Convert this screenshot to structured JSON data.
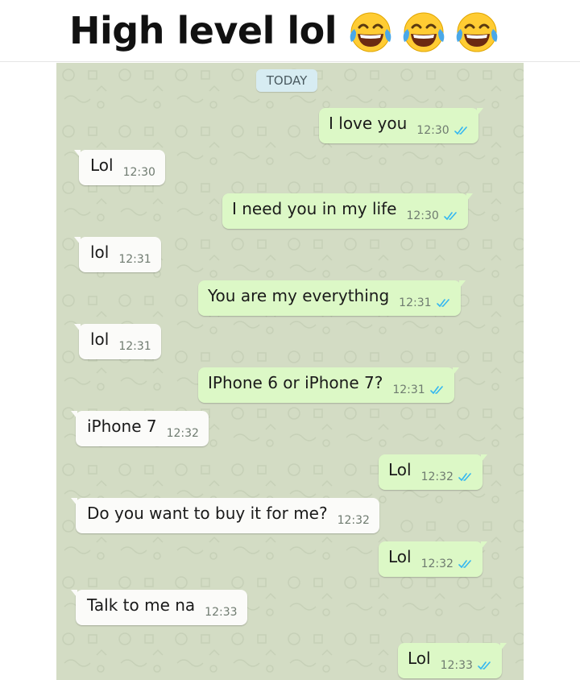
{
  "meme": {
    "caption": "High level lol",
    "emojis": [
      "face-with-tears-of-joy-icon",
      "face-with-tears-of-joy-icon",
      "face-with-tears-of-joy-icon"
    ]
  },
  "chat": {
    "date_label": "TODAY",
    "colors": {
      "outgoing": "#dcf8c6",
      "incoming": "#fbfbf9",
      "read_ticks": "#34b7f1",
      "wallpaper": "#d3dcc4"
    },
    "messages": [
      {
        "direction": "outgoing",
        "text": "I love you",
        "time": "12:30",
        "status": "read"
      },
      {
        "direction": "incoming",
        "text": "Lol",
        "time": "12:30"
      },
      {
        "direction": "outgoing",
        "text": "I need you in my life",
        "time": "12:30",
        "status": "read"
      },
      {
        "direction": "incoming",
        "text": "lol",
        "time": "12:31"
      },
      {
        "direction": "outgoing",
        "text": "You are my everything",
        "time": "12:31",
        "status": "read"
      },
      {
        "direction": "incoming",
        "text": "lol",
        "time": "12:31"
      },
      {
        "direction": "outgoing",
        "text": "IPhone 6 or iPhone 7?",
        "time": "12:31",
        "status": "read"
      },
      {
        "direction": "incoming",
        "text": "iPhone 7",
        "time": "12:32"
      },
      {
        "direction": "outgoing",
        "text": "Lol",
        "time": "12:32",
        "status": "read"
      },
      {
        "direction": "incoming",
        "text": "Do you want to buy it for me?",
        "time": "12:32"
      },
      {
        "direction": "outgoing",
        "text": "Lol",
        "time": "12:32",
        "status": "read"
      },
      {
        "direction": "incoming",
        "text": "Talk to me na",
        "time": "12:33"
      },
      {
        "direction": "outgoing",
        "text": "Lol",
        "time": "12:33",
        "status": "read"
      }
    ]
  }
}
